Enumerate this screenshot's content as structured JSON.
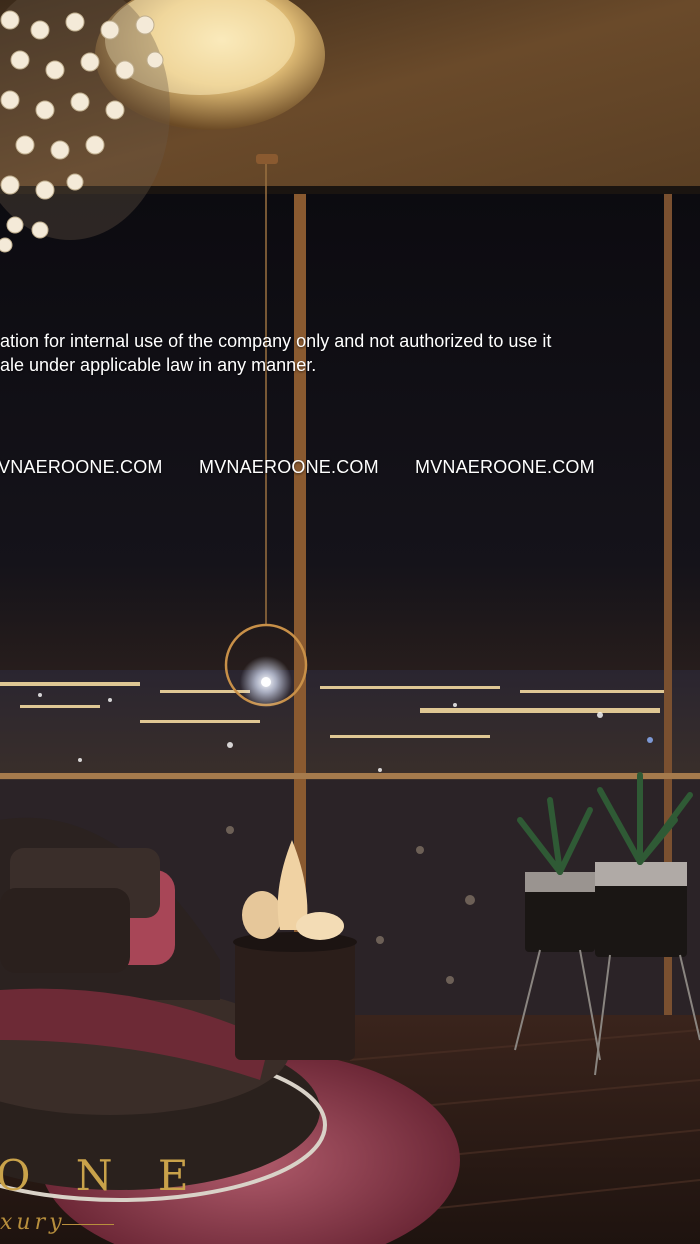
{
  "disclaimer": {
    "line1": "ation for internal use of the company only and not authorized to use it",
    "line2": "ale under applicable law in any manner."
  },
  "watermarks": [
    "MVNAEROONE.COM",
    "MVNAEROONE.COM",
    "MVNAEROONE.COM"
  ],
  "watermark_partial": "VNAEROONE.COM",
  "brand": {
    "logo_text": "O N E",
    "tagline": "xury"
  },
  "colors": {
    "accent_gold": "#c9a24a",
    "night_sky": "#111016",
    "wine": "#7a2a3a"
  }
}
